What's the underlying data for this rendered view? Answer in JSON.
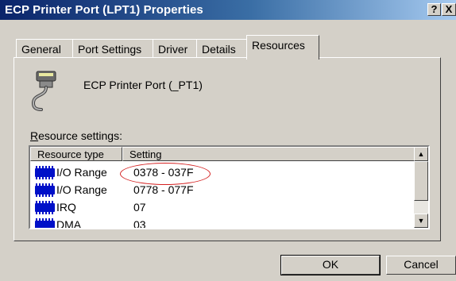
{
  "window": {
    "title": "ECP Printer Port (LPT1) Properties",
    "help_label": "?",
    "close_label": "X"
  },
  "tabs": [
    {
      "label": "General"
    },
    {
      "label": "Port Settings"
    },
    {
      "label": "Driver"
    },
    {
      "label": "Details"
    },
    {
      "label": "Resources",
      "active": true
    }
  ],
  "device": {
    "name": "ECP Printer Port (_PT1)",
    "icon": "parallel-port-cable-icon"
  },
  "resources": {
    "label_prefix": "R",
    "label_rest": "esource settings:",
    "columns": [
      "Resource type",
      "Setting"
    ],
    "rows": [
      {
        "type": "I/O Range",
        "setting": "0378 - 037F",
        "icon": "chip-icon"
      },
      {
        "type": "I/O Range",
        "setting": "0778 - 077F",
        "icon": "chip-icon"
      },
      {
        "type": "IRQ",
        "setting": "07",
        "icon": "chip-icon"
      },
      {
        "type": "DMA",
        "setting": "03",
        "icon": "chip-icon"
      }
    ]
  },
  "buttons": {
    "ok": "OK",
    "cancel": "Cancel"
  },
  "colors": {
    "title_start": "#0a246a",
    "title_end": "#a6caf0",
    "chip": "#0010c8",
    "annotation": "#d42020"
  }
}
